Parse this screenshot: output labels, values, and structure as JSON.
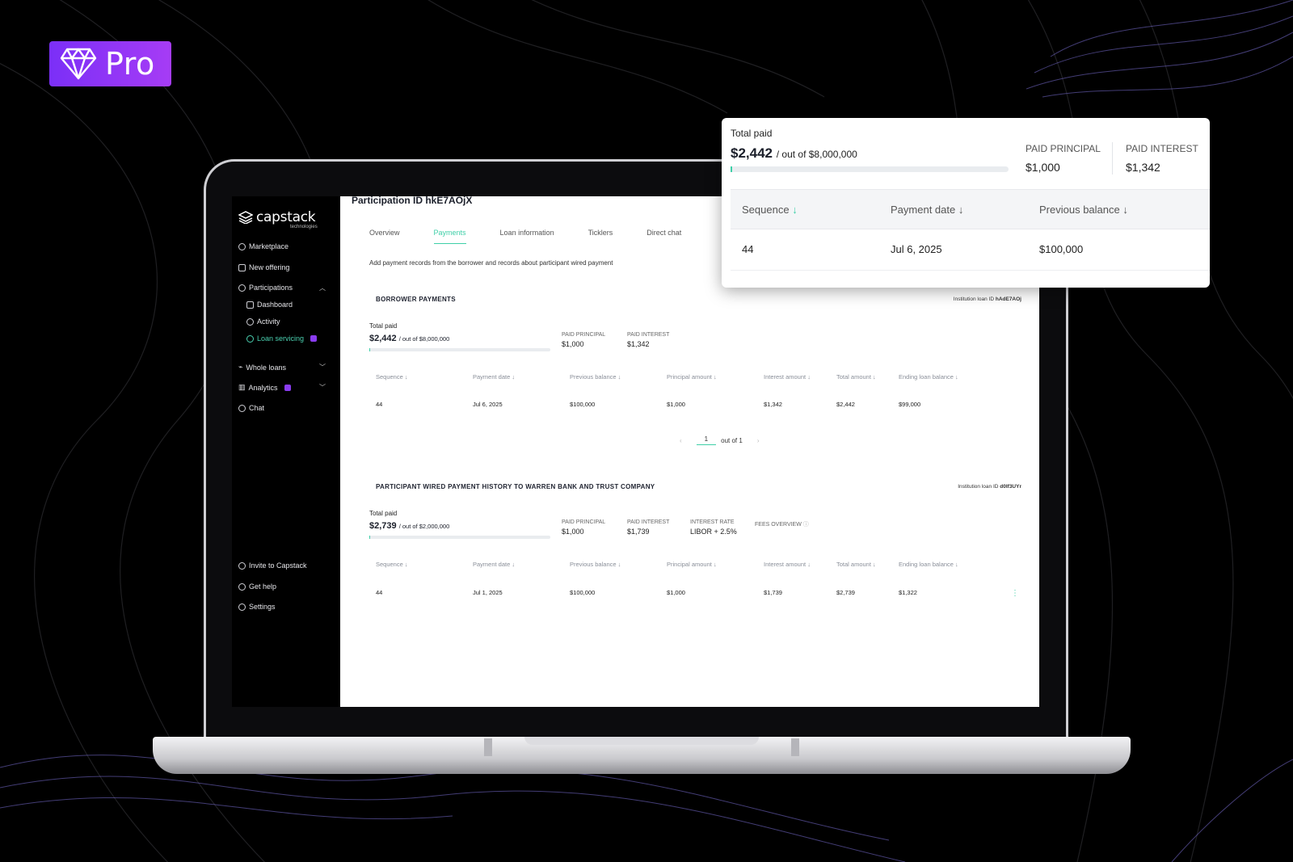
{
  "badge": {
    "label": "Pro"
  },
  "logo": {
    "word": "capstack",
    "sub": "technologies"
  },
  "sidebar": {
    "items": [
      {
        "label": "Marketplace"
      },
      {
        "label": "New offering"
      },
      {
        "label": "Participations"
      },
      {
        "label": "Dashboard"
      },
      {
        "label": "Activity"
      },
      {
        "label": "Loan servicing"
      },
      {
        "label": "Whole loans"
      },
      {
        "label": "Analytics"
      },
      {
        "label": "Chat"
      }
    ],
    "bottom": [
      {
        "label": "Invite to Capstack"
      },
      {
        "label": "Get help"
      },
      {
        "label": "Settings"
      }
    ]
  },
  "page": {
    "title": "Participation ID hkE7AOjX",
    "tabs": [
      "Overview",
      "Payments",
      "Loan information",
      "Ticklers",
      "Direct chat"
    ],
    "hint": "Add payment records from the borrower and records about participant wired payment"
  },
  "borrower": {
    "title": "BORROWER PAYMENTS",
    "inst_label": "Institution loan ID",
    "inst_id": "hAdE7AOj",
    "total_label": "Total paid",
    "total": "$2,442",
    "total_of": "/ out of $8,000,000",
    "paid_principal_label": "PAID PRINCIPAL",
    "paid_principal": "$1,000",
    "paid_interest_label": "PAID INTEREST",
    "paid_interest": "$1,342",
    "columns": [
      "Sequence ↓",
      "Payment date ↓",
      "Previous balance ↓",
      "Principal amount ↓",
      "Interest amount ↓",
      "Total amount ↓",
      "Ending loan balance ↓"
    ],
    "row": [
      "44",
      "Jul 6, 2025",
      "$100,000",
      "$1,000",
      "$1,342",
      "$2,442",
      "$99,000"
    ],
    "pager_page": "1",
    "pager_of": "out of 1"
  },
  "participant": {
    "title": "PARTICIPANT WIRED PAYMENT HISTORY TO WARREN BANK AND TRUST COMPANY",
    "inst_label": "Institution loan ID",
    "inst_id": "d0If3UYr",
    "total_label": "Total paid",
    "total": "$2,739",
    "total_of": "/ out of $2,000,000",
    "paid_principal_label": "PAID PRINCIPAL",
    "paid_principal": "$1,000",
    "paid_interest_label": "PAID INTEREST",
    "paid_interest": "$1,739",
    "interest_rate_label": "INTEREST RATE",
    "interest_rate": "LIBOR + 2.5%",
    "fees_label": "FEES OVERVIEW",
    "columns": [
      "Sequence ↓",
      "Payment date ↓",
      "Previous balance ↓",
      "Principal amount ↓",
      "Interest amount ↓",
      "Total amount ↓",
      "Ending loan balance ↓"
    ],
    "row": [
      "44",
      "Jul 1, 2025",
      "$100,000",
      "$1,000",
      "$1,739",
      "$2,739",
      "$1,322"
    ]
  },
  "card": {
    "total_label": "Total paid",
    "total": "$2,442",
    "total_of": "/ out of $8,000,000",
    "paid_principal_label": "PAID PRINCIPAL",
    "paid_principal": "$1,000",
    "paid_interest_label": "PAID INTEREST",
    "paid_interest": "$1,342",
    "columns": [
      "Sequence",
      "Payment date",
      "Previous balance"
    ],
    "sort_arrow": "↓",
    "row": [
      "44",
      "Jul 6, 2025",
      "$100,000"
    ]
  },
  "colors": {
    "accent": "#3fcfa8",
    "badge": "#8a3cf0",
    "background": "#000000"
  }
}
